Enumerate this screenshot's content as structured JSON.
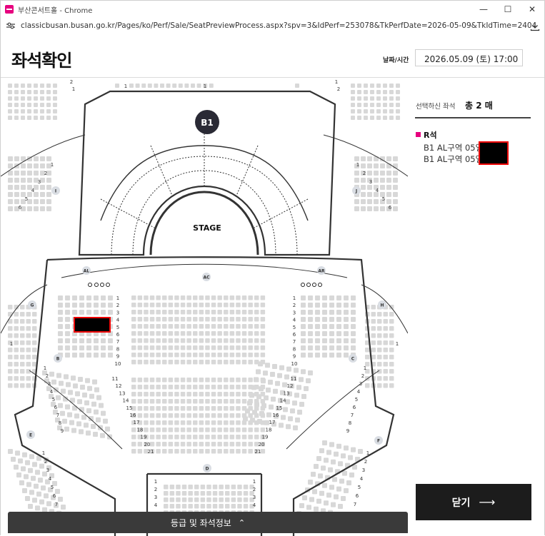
{
  "window": {
    "title": "부산콘서트홀 - Chrome",
    "url": "classicbusan.busan.go.kr/Pages/ko/Perf/Sale/SeatPreviewProcess.aspx?spv=3&IdPerf=253078&TkPerfDate=2026-05-09&TkIdTime=24048&TkBlock=..."
  },
  "header": {
    "title": "좌석확인",
    "date_label": "날짜/시간",
    "date_value": "2026.05.09 (토) 17:00"
  },
  "seatmap": {
    "stage_label": "STAGE",
    "block_b1": "B1",
    "section_labels": [
      "AL",
      "AC",
      "AR",
      "G",
      "H",
      "B",
      "C",
      "E",
      "F",
      "I",
      "J",
      "D"
    ],
    "center_left_rows": [
      "1",
      "2",
      "3",
      "4",
      "5",
      "6",
      "7",
      "8",
      "9",
      "10"
    ],
    "center_right_rows": [
      "1",
      "2",
      "3",
      "4",
      "5",
      "6",
      "7",
      "8",
      "9",
      "10"
    ],
    "lower_rows": [
      "11",
      "12",
      "13",
      "14",
      "15",
      "16",
      "17",
      "18",
      "19",
      "20",
      "21"
    ],
    "left_side_rows": [
      "1",
      "2",
      "3",
      "4",
      "5",
      "6",
      "7",
      "8",
      "9"
    ],
    "right_side_rows": [
      "1",
      "2",
      "3",
      "4",
      "5",
      "6",
      "7",
      "8",
      "9"
    ],
    "ring_left_rows": [
      "1",
      "2",
      "3",
      "4",
      "5",
      "6"
    ],
    "ring_right_rows": [
      "1",
      "2",
      "3",
      "4",
      "5",
      "6"
    ],
    "top_left_rows": [
      "2",
      "1"
    ],
    "top_right_rows": [
      "1",
      "2"
    ],
    "e_rows": [
      "1",
      "2",
      "3",
      "4",
      "5",
      "6",
      "7"
    ],
    "f_rows": [
      "1",
      "2",
      "3",
      "4",
      "5",
      "6",
      "7"
    ],
    "d_rows": [
      "1",
      "2",
      "3",
      "4"
    ],
    "g_side_row": "1",
    "h_side_row": "1",
    "b1_small": "1",
    "d_small": "1",
    "colors": {
      "seat": "#d8d8d8",
      "line": "#333333",
      "badge": "#d9dde3"
    }
  },
  "selection": {
    "label": "선택하신 좌석",
    "count": "총 2 매",
    "grade": "R석",
    "seats": [
      "B1 AL구역 05열",
      "B1 AL구역 05열"
    ],
    "accent": "#e6007e"
  },
  "close_button": {
    "label": "닫기",
    "arrow": "⟶"
  },
  "bottom_bar": {
    "label": "등급 및 좌석정보",
    "chevron": "⌃"
  }
}
